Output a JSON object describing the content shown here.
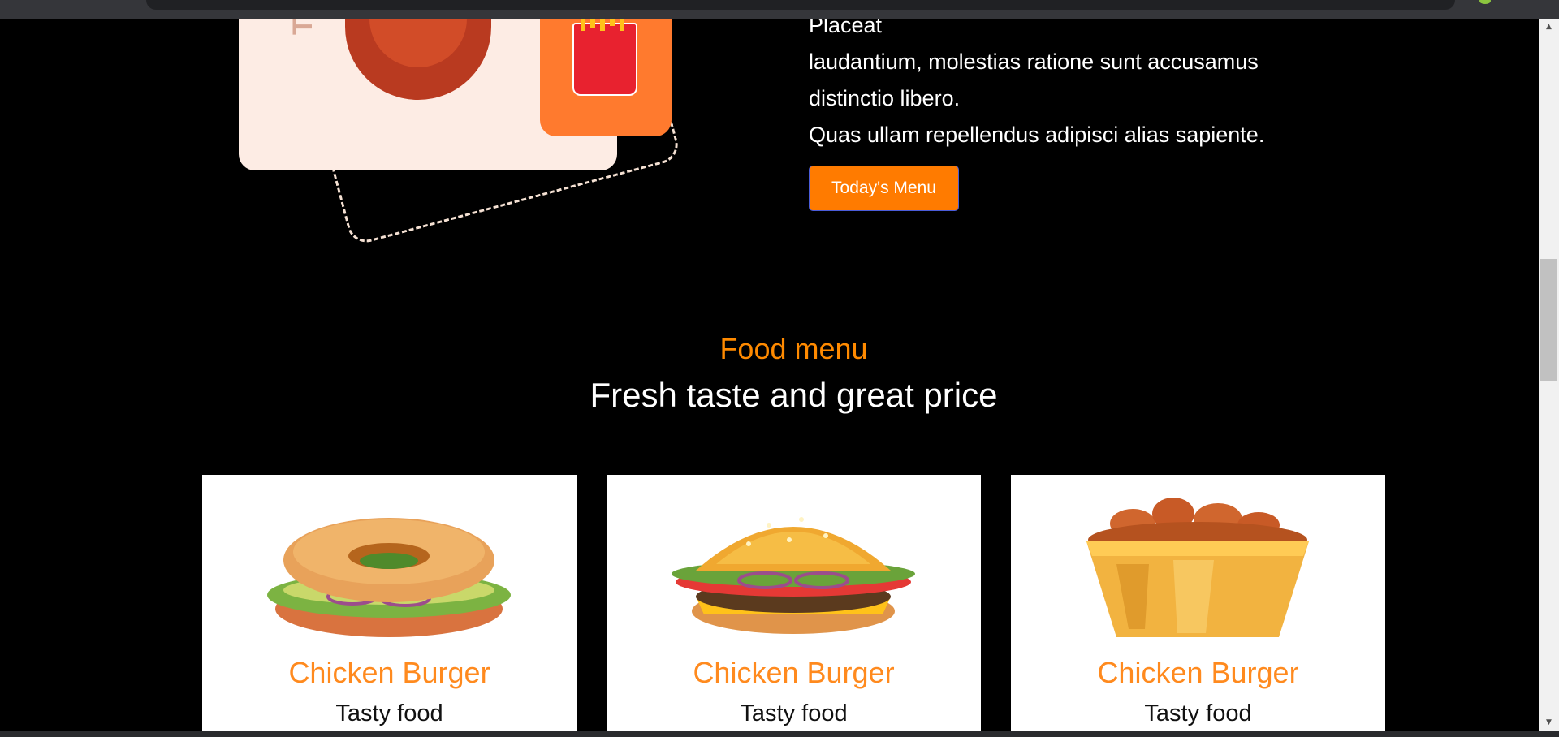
{
  "hero": {
    "lines": [
      "Placeat",
      "laudantium, molestias ratione sunt accusamus",
      "distinctio libero.",
      "Quas ullam repellendus adipisci alias sapiente."
    ],
    "button_label": "Today's Menu",
    "illustration_text": "Tod"
  },
  "menu": {
    "kicker": "Food menu",
    "title": "Fresh taste and great price",
    "items": [
      {
        "name": "Chicken Burger",
        "desc": "Tasty food",
        "icon": "bagel-sandwich-icon"
      },
      {
        "name": "Chicken Burger",
        "desc": "Tasty food",
        "icon": "burger-icon"
      },
      {
        "name": "Chicken Burger",
        "desc": "Tasty food",
        "icon": "fried-chicken-bucket-icon"
      }
    ]
  },
  "colors": {
    "accent": "#ff8a00",
    "button": "#ff7b00",
    "background": "#000000",
    "card": "#ffffff"
  }
}
